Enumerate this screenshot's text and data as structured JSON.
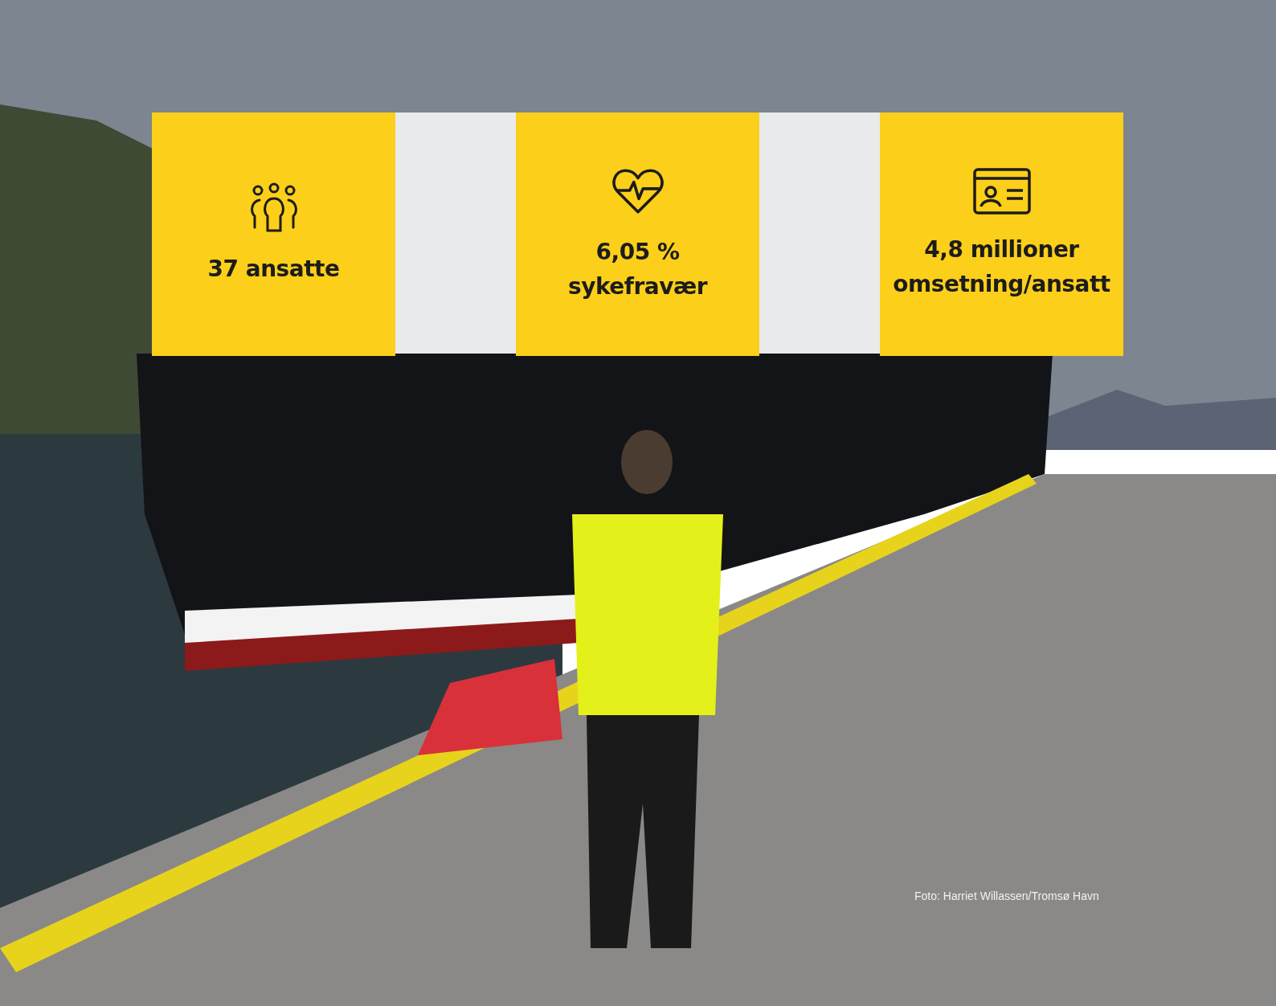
{
  "stats": [
    {
      "kind": "people",
      "lines": [
        "37 ansatte"
      ]
    },
    {
      "kind": "heart",
      "lines": [
        "6,05 %",
        "sykefravær"
      ]
    },
    {
      "kind": "id-card",
      "lines": [
        "4,8 millioner",
        "omsetning/ansatt"
      ]
    }
  ],
  "credit": "Foto: Harriet Willassen/Tromsø Havn"
}
